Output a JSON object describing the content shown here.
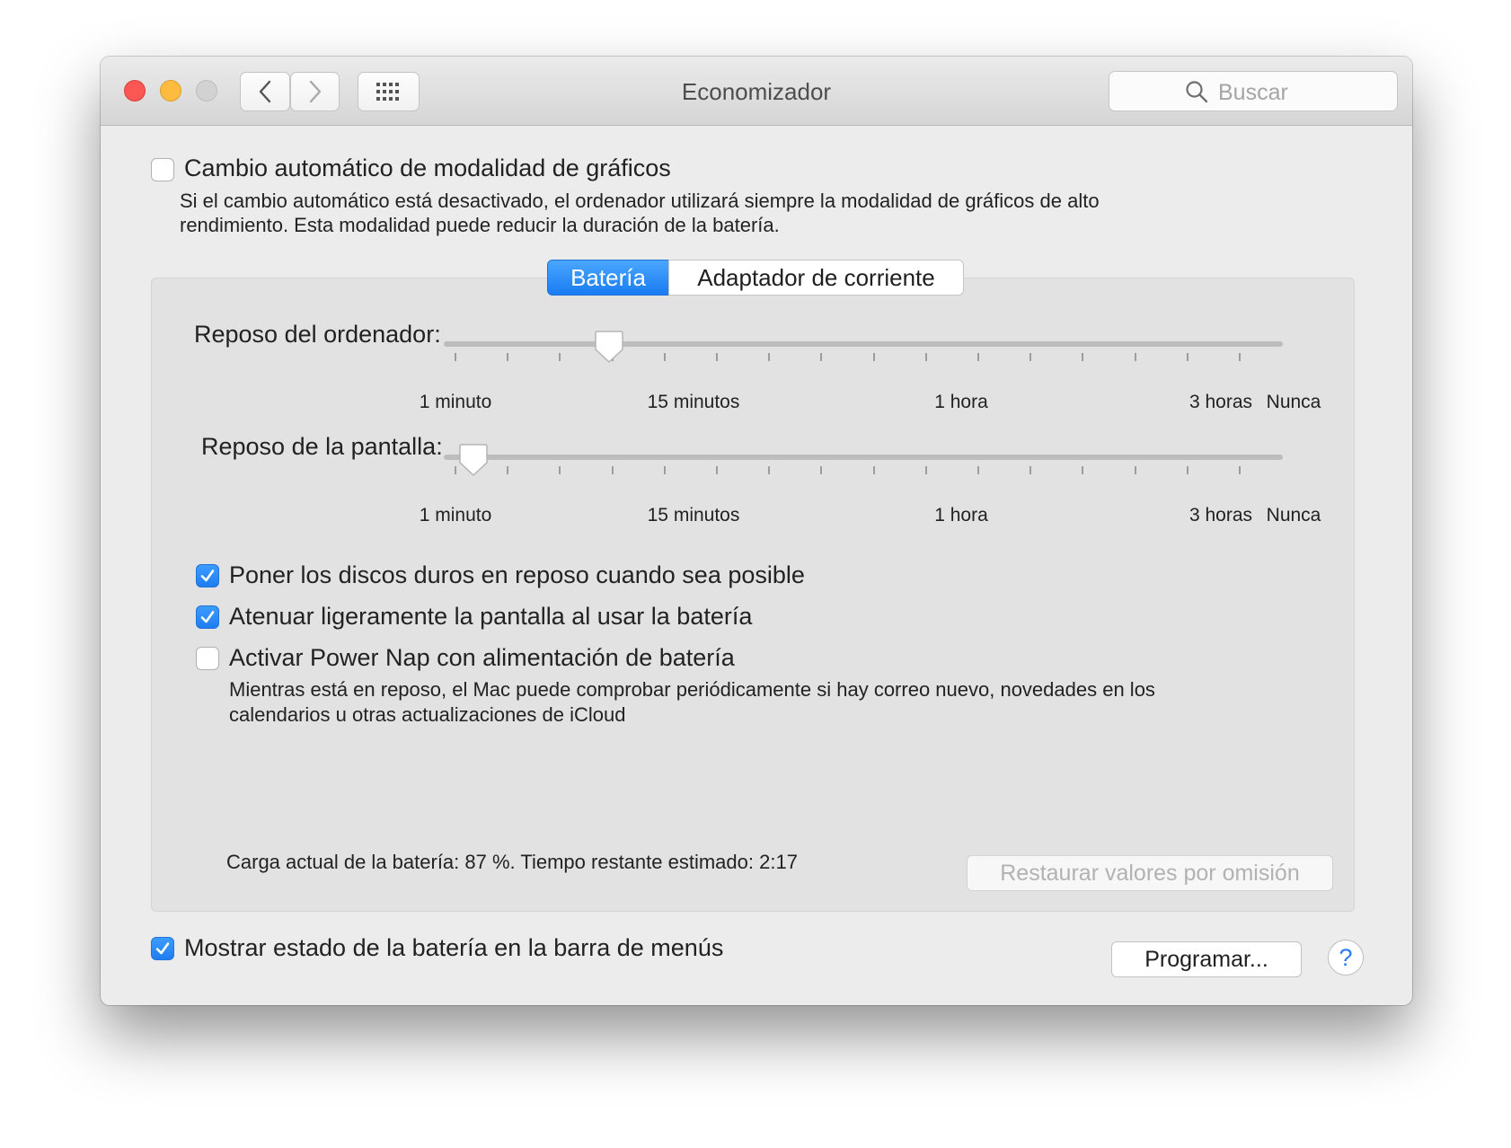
{
  "window": {
    "title": "Economizador",
    "search_placeholder": "Buscar"
  },
  "graphics": {
    "switch_label": "Cambio automático de modalidad de gráficos",
    "switch_checked": false,
    "description_line1": "Si el cambio automático está desactivado, el ordenador utilizará siempre la modalidad de gráficos de alto",
    "description_line2": "rendimiento. Esta modalidad puede reducir la duración de la batería."
  },
  "tabs": {
    "battery": "Batería",
    "power_adapter": "Adaptador de corriente",
    "selected": "battery"
  },
  "computer_sleep": {
    "label": "Reposo del ordenador:",
    "value": "15 minutos",
    "tick_labels": [
      "1 minuto",
      "15 minutos",
      "1 hora",
      "3 horas",
      "Nunca"
    ]
  },
  "display_sleep": {
    "label": "Reposo de la pantalla:",
    "value": "2 minutos",
    "tick_labels": [
      "1 minuto",
      "15 minutos",
      "1 hora",
      "3 horas",
      "Nunca"
    ]
  },
  "options": {
    "hard_disks": {
      "label": "Poner los discos duros en reposo cuando sea posible",
      "checked": true
    },
    "dim_display": {
      "label": "Atenuar ligeramente la pantalla al usar la batería",
      "checked": true
    },
    "power_nap": {
      "label": "Activar Power Nap con alimentación de batería",
      "checked": false,
      "description_line1": "Mientras está en reposo, el Mac puede comprobar periódicamente si hay correo nuevo, novedades en los",
      "description_line2": "calendarios u otras actualizaciones de iCloud"
    }
  },
  "status": {
    "battery_text": "Carga actual de la batería: 87 %. Tiempo restante estimado: 2:17"
  },
  "buttons": {
    "restore_defaults": "Restaurar valores por omisión",
    "schedule": "Programar...",
    "help": "?"
  },
  "menubar_option": {
    "label": "Mostrar estado de la batería en la barra de menús",
    "checked": true
  },
  "colors": {
    "accent": "#1f7ef0",
    "window_background": "#ececec",
    "panel_background": "#e2e2e2"
  }
}
